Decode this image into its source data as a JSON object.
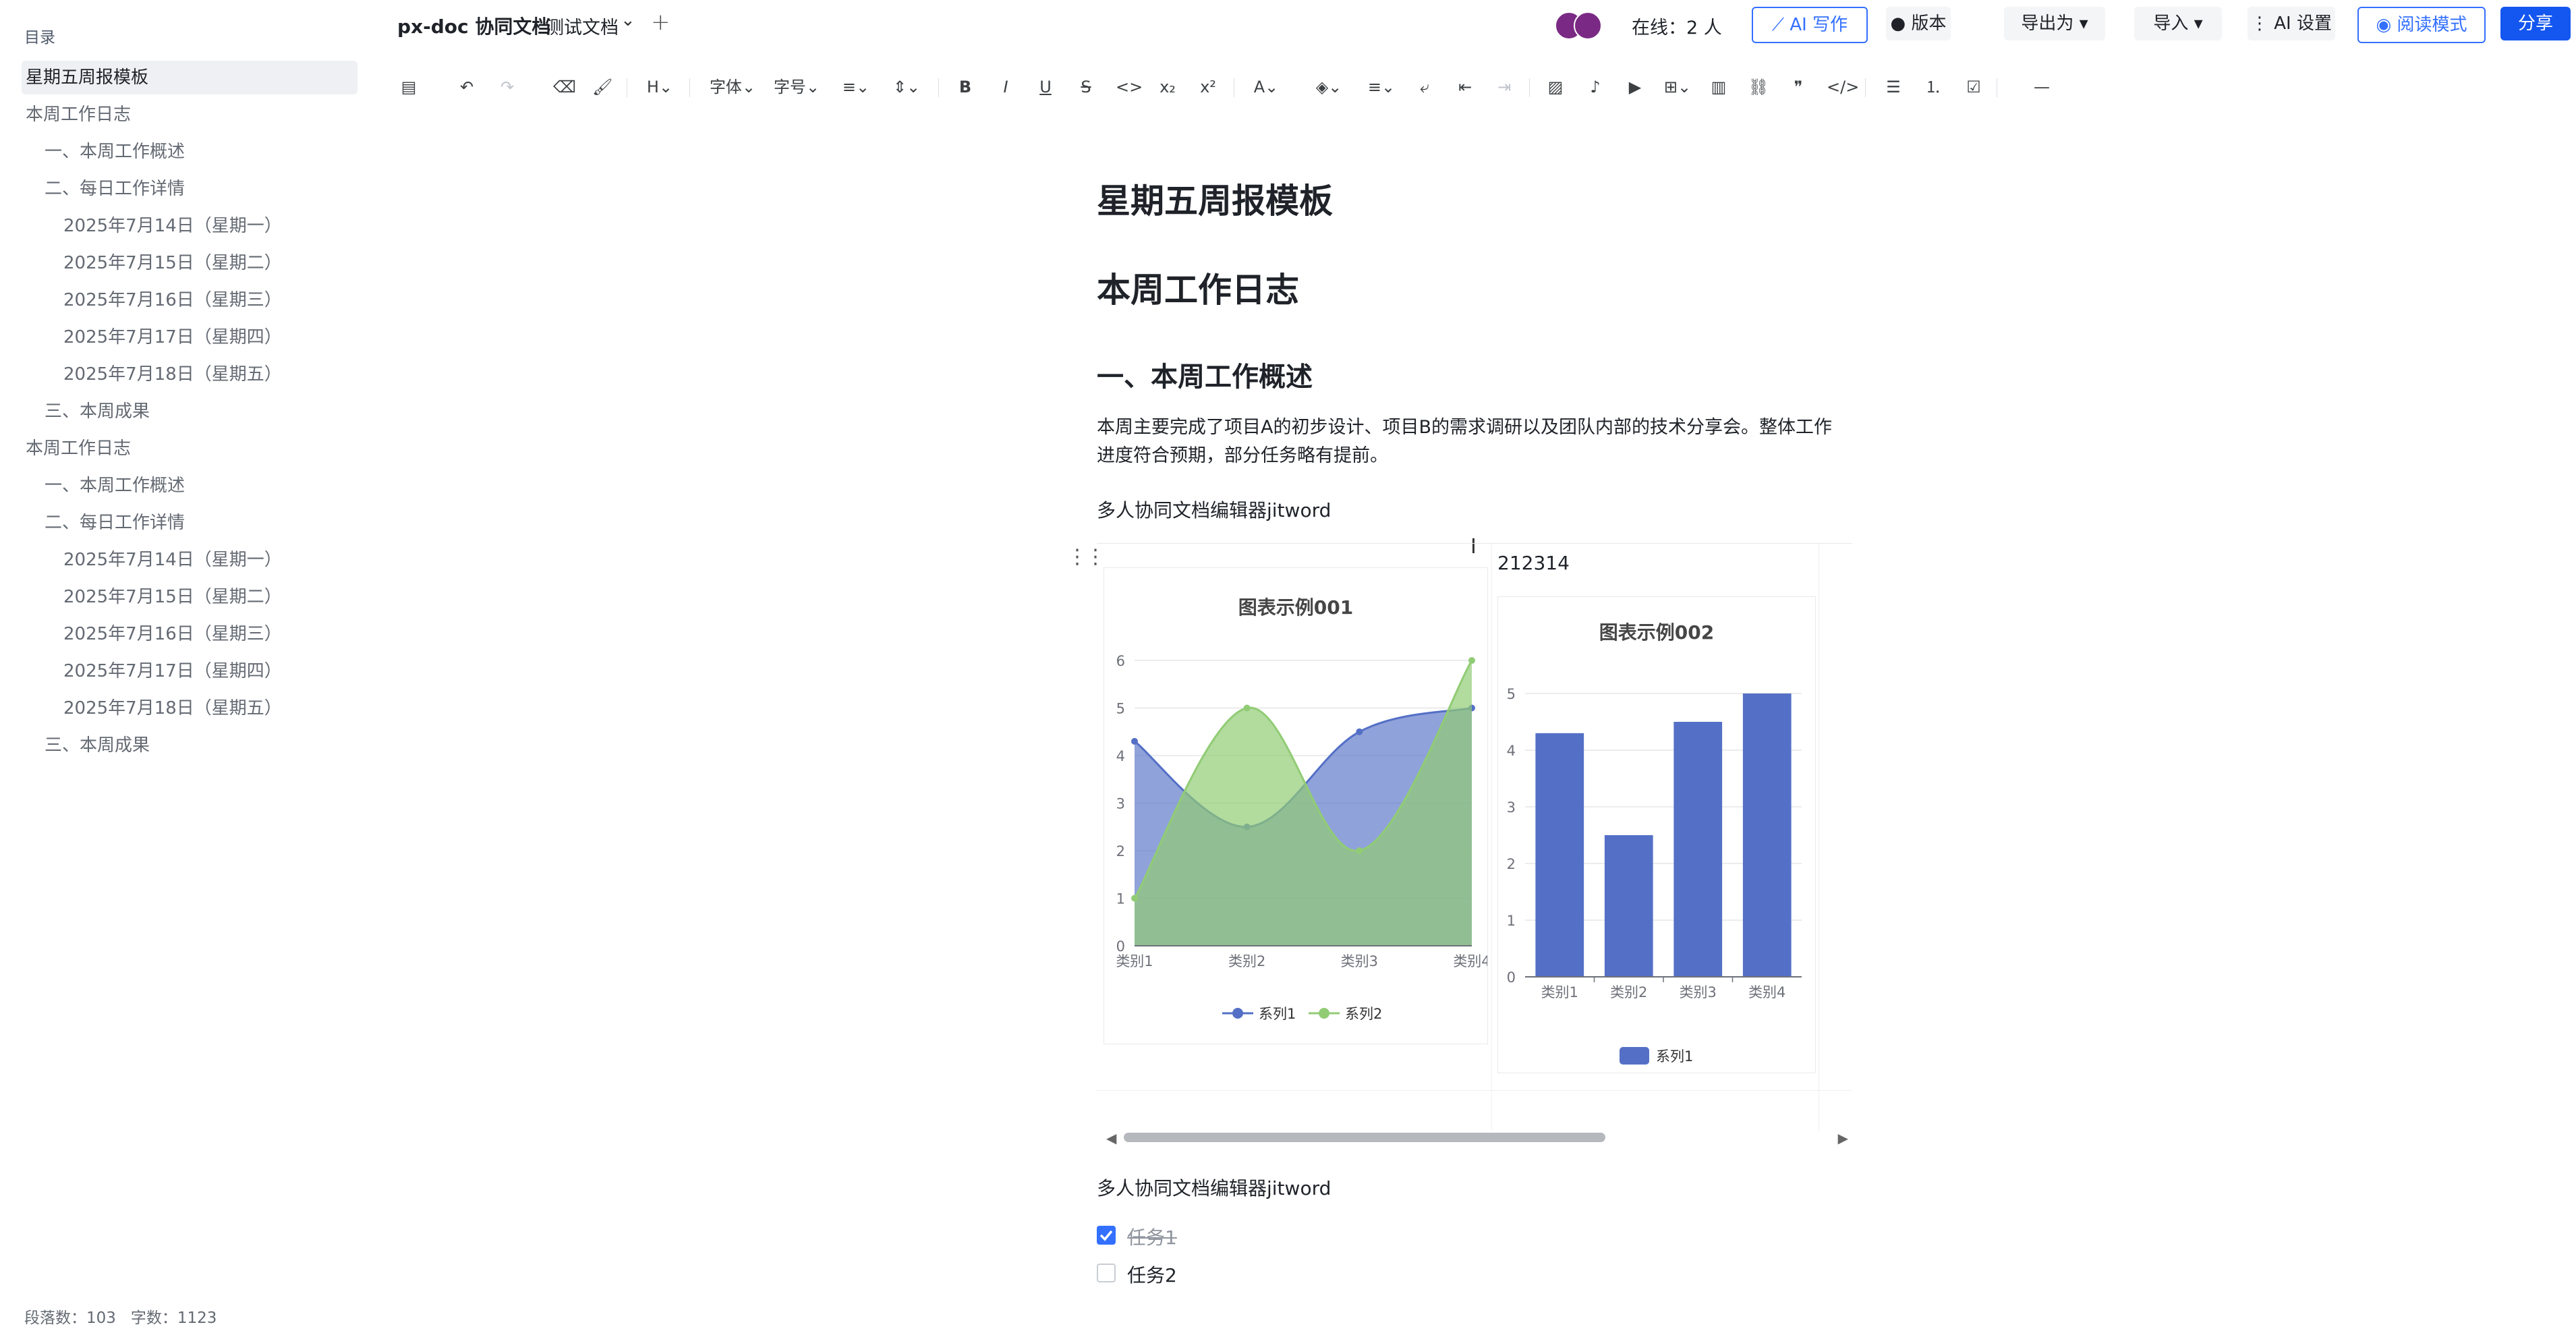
{
  "sidebar": {
    "title": "目录",
    "items": [
      {
        "label": "星期五周报模板",
        "level": 0,
        "active": true
      },
      {
        "label": "本周工作日志",
        "level": 0
      },
      {
        "label": "一、本周工作概述",
        "level": 1
      },
      {
        "label": "二、每日工作详情",
        "level": 1
      },
      {
        "label": "2025年7月14日（星期一）",
        "level": 2
      },
      {
        "label": "2025年7月15日（星期二）",
        "level": 2
      },
      {
        "label": "2025年7月16日（星期三）",
        "level": 2
      },
      {
        "label": "2025年7月17日（星期四）",
        "level": 2
      },
      {
        "label": "2025年7月18日（星期五）",
        "level": 2
      },
      {
        "label": "三、本周成果",
        "level": 1
      },
      {
        "label": "本周工作日志",
        "level": 0
      },
      {
        "label": "一、本周工作概述",
        "level": 1
      },
      {
        "label": "二、每日工作详情",
        "level": 1
      },
      {
        "label": "2025年7月14日（星期一）",
        "level": 2
      },
      {
        "label": "2025年7月15日（星期二）",
        "level": 2
      },
      {
        "label": "2025年7月16日（星期三）",
        "level": 2
      },
      {
        "label": "2025年7月17日（星期四）",
        "level": 2
      },
      {
        "label": "2025年7月18日（星期五）",
        "level": 2
      },
      {
        "label": "三、本周成果",
        "level": 1
      }
    ]
  },
  "header": {
    "app_title": "px-doc 协同文档",
    "doc_name": "测试文档",
    "online": "在线：2 人",
    "ai_write": "AI 写作",
    "version": "版本",
    "export": "导出为",
    "import": "导入",
    "ai_settings": "AI 设置",
    "read_mode": "阅读模式",
    "share": "分享"
  },
  "toolbar": {
    "font": "字体",
    "size": "字号"
  },
  "document": {
    "title": "星期五周报模板",
    "h_log": "本周工作日志",
    "h_overview": "一、本周工作概述",
    "para": "本周主要完成了项目A的初步设计、项目B的需求调研以及团队内部的技术分享会。整体工作进度符合预期，部分任务略有提前。",
    "editor_line1": "多人协同文档编辑器jitword",
    "cell_text": "212314",
    "editor_line2": "多人协同文档编辑器jitword",
    "tasks": [
      {
        "label": "任务1",
        "done": true
      },
      {
        "label": "任务2",
        "done": false
      }
    ]
  },
  "chart_data": [
    {
      "type": "area",
      "title": "图表示例001",
      "categories": [
        "类别1",
        "类别2",
        "类别3",
        "类别4"
      ],
      "ylim": [
        0,
        6
      ],
      "yticks": [
        0,
        1,
        2,
        3,
        4,
        5,
        6
      ],
      "series": [
        {
          "name": "系列1",
          "values": [
            4.3,
            2.5,
            4.5,
            5
          ],
          "color": "#5470c6"
        },
        {
          "name": "系列2",
          "values": [
            1,
            5,
            2,
            6
          ],
          "color": "#91cc75"
        }
      ],
      "legend": "bottom"
    },
    {
      "type": "bar",
      "title": "图表示例002",
      "categories": [
        "类别1",
        "类别2",
        "类别3",
        "类别4"
      ],
      "ylim": [
        0,
        5
      ],
      "yticks": [
        0,
        1,
        2,
        3,
        4,
        5
      ],
      "series": [
        {
          "name": "系列1",
          "values": [
            4.3,
            2.5,
            4.5,
            5
          ],
          "color": "#5470c6"
        }
      ],
      "legend": "bottom"
    }
  ],
  "status": {
    "paragraphs": "段落数：103",
    "words": "字数：1123"
  }
}
